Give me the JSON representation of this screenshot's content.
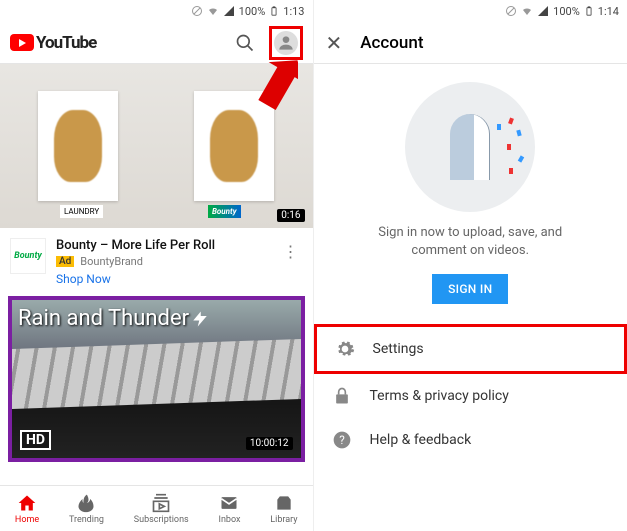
{
  "status": {
    "battery": "100%",
    "time_left": "1:13",
    "time_right": "1:14"
  },
  "left": {
    "logo_text": "YouTube",
    "video1": {
      "duration": "0:16",
      "brand_small1": "LAUNDRY",
      "brand_small2": "Bounty",
      "icon_label": "Bounty",
      "title": "Bounty – More Life Per Roll",
      "ad_badge": "Ad",
      "channel": "BountyBrand",
      "cta": "Shop Now"
    },
    "video2": {
      "title": "Rain and Thunder",
      "hd": "HD",
      "duration": "10:00:12"
    },
    "nav": {
      "home": "Home",
      "trending": "Trending",
      "subscriptions": "Subscriptions",
      "inbox": "Inbox",
      "library": "Library"
    }
  },
  "right": {
    "title": "Account",
    "hero_line1": "Sign in now to upload, save, and",
    "hero_line2": "comment on videos.",
    "signin": "SIGN IN",
    "menu": {
      "settings": "Settings",
      "terms": "Terms & privacy policy",
      "help": "Help & feedback"
    }
  }
}
